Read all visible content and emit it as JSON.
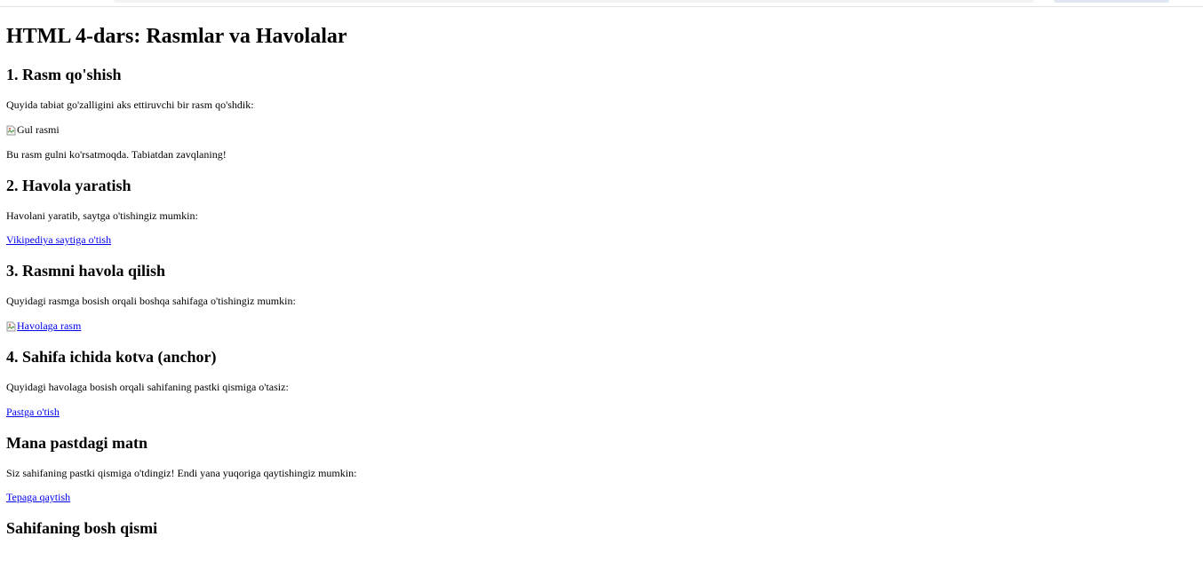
{
  "page": {
    "title": "HTML 4-dars: Rasmlar va Havolalar"
  },
  "section1": {
    "heading": "1. Rasm qo'shish",
    "intro": "Quyida tabiat go'zalligini aks ettiruvchi bir rasm qo'shdik:",
    "image_alt": "Gul rasmi",
    "caption": "Bu rasm gulni ko'rsatmoqda. Tabiatdan zavqlaning!"
  },
  "section2": {
    "heading": "2. Havola yaratish",
    "intro": "Havolani yaratib, saytga o'tishingiz mumkin:",
    "link_text": "Vikipediya saytiga o'tish"
  },
  "section3": {
    "heading": "3. Rasmni havola qilish",
    "intro": "Quyidagi rasmga bosish orqali boshqa sahifaga o'tishingiz mumkin:",
    "image_link_alt": "Havolaga rasm"
  },
  "section4": {
    "heading": "4. Sahifa ichida kotva (anchor)",
    "intro": "Quyidagi havolaga bosish orqali sahifaning pastki qismiga o'tasiz:",
    "link_text": "Pastga o'tish"
  },
  "bottom": {
    "heading": "Mana pastdagi matn",
    "text": "Siz sahifaning pastki qismiga o'tdingiz! Endi yana yuqoriga qaytishingiz mumkin:",
    "link_text": "Tepaga qaytish"
  },
  "top_section": {
    "heading": "Sahifaning bosh qismi"
  },
  "colors": {
    "link": "#0000ee",
    "text": "#000000",
    "background": "#ffffff"
  }
}
